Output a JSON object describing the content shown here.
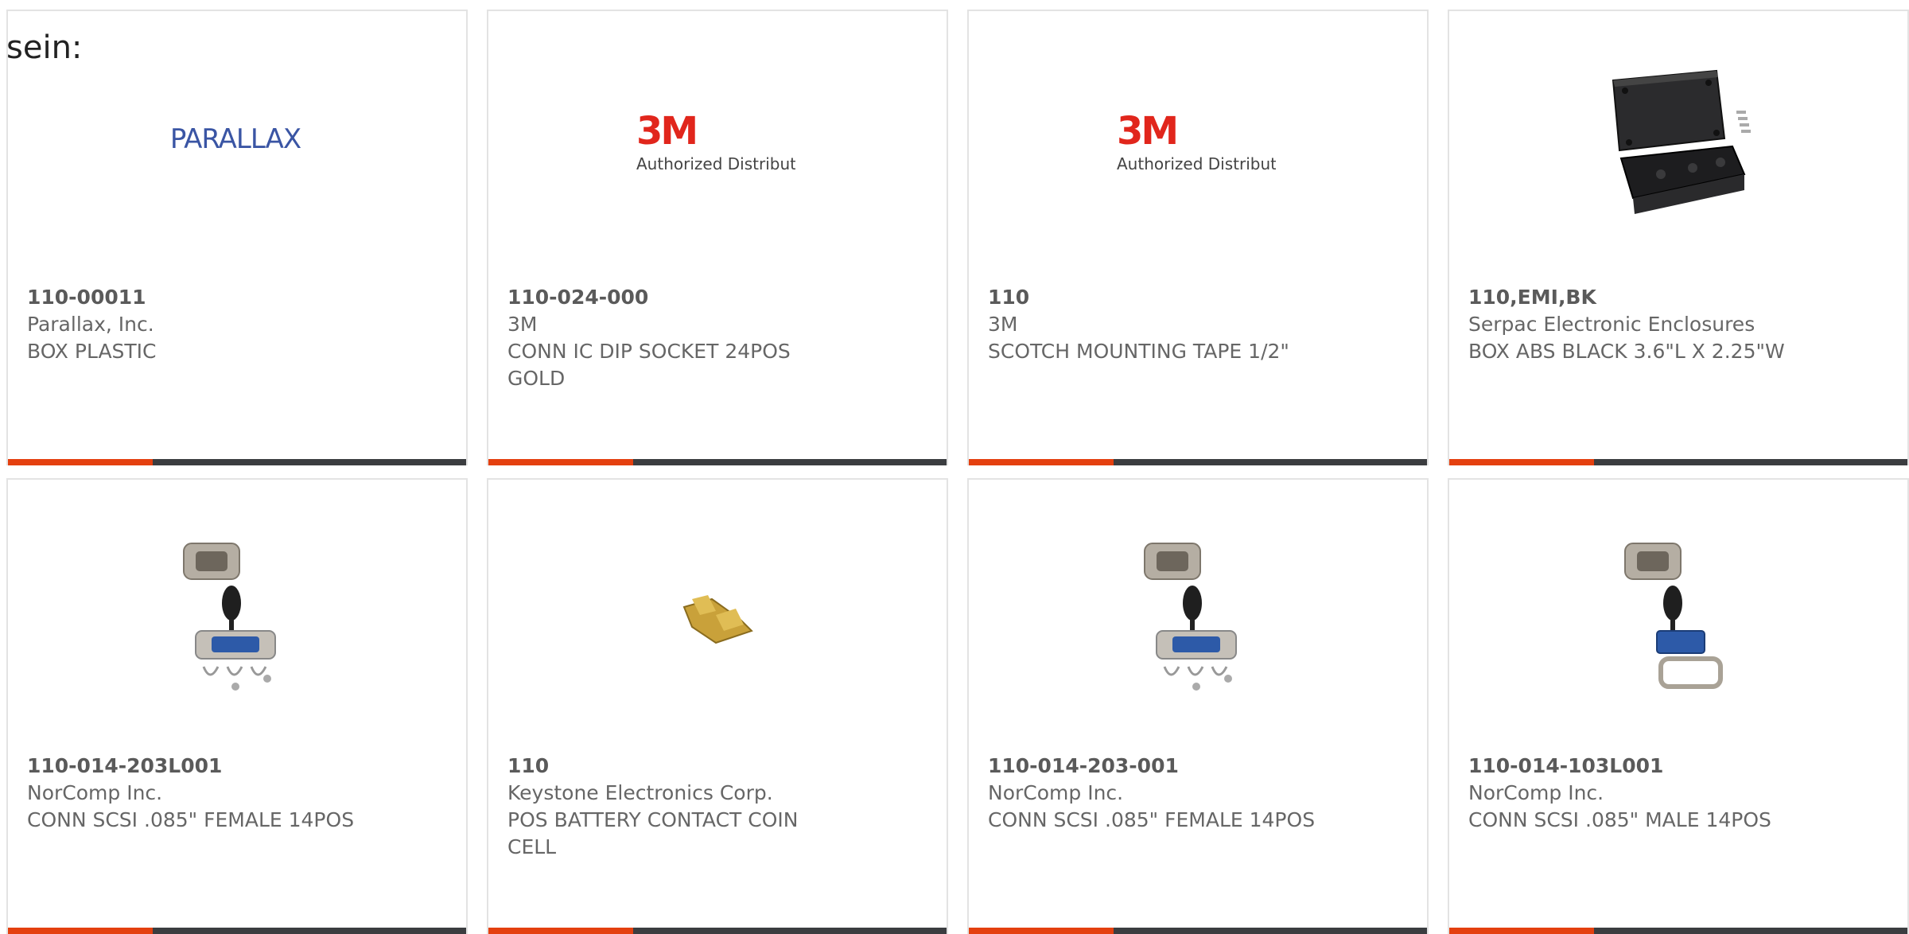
{
  "lead_text": "sein:",
  "products": [
    {
      "part": "110-00011",
      "manufacturer": "Parallax, Inc.",
      "description": "BOX PLASTIC",
      "image": "parallax-logo"
    },
    {
      "part": "110-024-000",
      "manufacturer": "3M",
      "description": "CONN IC DIP SOCKET 24POS GOLD",
      "image": "3m-logo"
    },
    {
      "part": "110",
      "manufacturer": "3M",
      "description": "SCOTCH MOUNTING TAPE 1/2\"",
      "image": "3m-logo"
    },
    {
      "part": "110,EMI,BK",
      "manufacturer": "Serpac Electronic Enclosures",
      "description": "BOX ABS BLACK 3.6\"L X 2.25\"W",
      "image": "black-enclosure"
    },
    {
      "part": "110-014-203L001",
      "manufacturer": "NorComp Inc.",
      "description": "CONN SCSI .085\" FEMALE 14POS",
      "image": "scsi-connector-kit"
    },
    {
      "part": "110",
      "manufacturer": "Keystone Electronics Corp.",
      "description": "POS BATTERY CONTACT COIN CELL",
      "image": "battery-contact"
    },
    {
      "part": "110-014-203-001",
      "manufacturer": "NorComp Inc.",
      "description": "CONN SCSI .085\" FEMALE 14POS",
      "image": "scsi-connector-kit"
    },
    {
      "part": "110-014-103L001",
      "manufacturer": "NorComp Inc.",
      "description": "CONN SCSI .085\" MALE 14POS",
      "image": "scsi-connector-male-kit"
    }
  ],
  "logos": {
    "parallax": "PARALLAX",
    "three_m": "3M",
    "three_m_sub": "Authorized Distributor"
  },
  "colors": {
    "accent": "#e4400f",
    "bar": "#3b3d40",
    "parallax_blue": "#3a55a4",
    "three_m_red": "#e1261c"
  }
}
